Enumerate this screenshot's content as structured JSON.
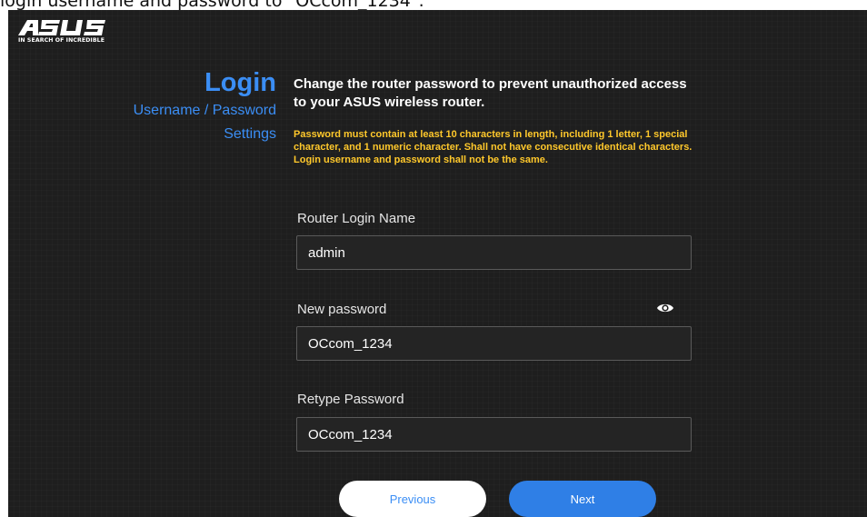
{
  "caption": "login username and password to \"OCcom_1234\".",
  "brand": {
    "logo": "ASUS",
    "tagline": "IN SEARCH OF INCREDIBLE"
  },
  "sidebar": {
    "title": "Login",
    "items": [
      {
        "label": "Username / Password"
      },
      {
        "label": "Settings"
      }
    ]
  },
  "main": {
    "heading": "Change the router password to prevent unauthorized access to your ASUS wireless router.",
    "warning": "Password must contain at least 10 characters in length, including 1 letter, 1 special character, and 1 numeric character. Shall not have consecutive identical characters. Login username and password shall not be the same."
  },
  "form": {
    "login_name": {
      "label": "Router Login Name",
      "value": "admin"
    },
    "new_password": {
      "label": "New password",
      "value": "OCcom_1234",
      "toggle_icon": "eye-icon"
    },
    "retype_password": {
      "label": "Retype Password",
      "value": "OCcom_1234"
    }
  },
  "buttons": {
    "previous": "Previous",
    "next": "Next"
  },
  "colors": {
    "accent": "#3b8ef5",
    "warning": "#ffc82b",
    "background": "#1e1e1e",
    "next_button": "#2f7fe6"
  }
}
